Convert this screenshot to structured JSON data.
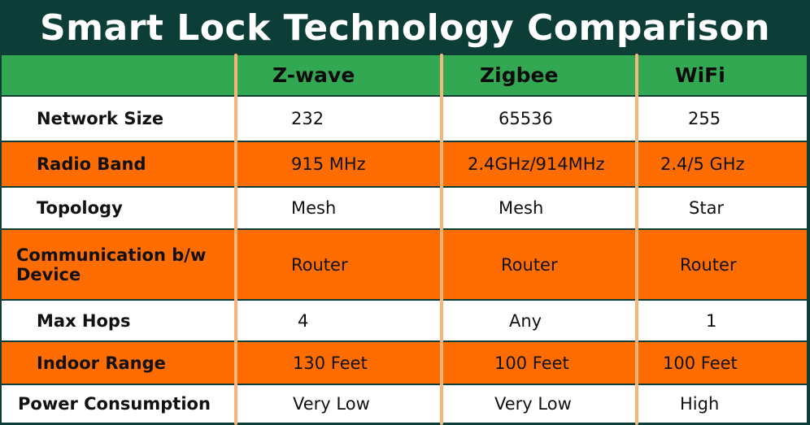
{
  "title": "Smart Lock Technology Comparison",
  "columns": [
    "Z-wave",
    "Zigbee",
    "WiFi"
  ],
  "rows": [
    {
      "label": "Network Size",
      "values": [
        "232",
        "65536",
        "255"
      ]
    },
    {
      "label": "Radio Band",
      "values": [
        "915 MHz",
        "2.4GHz/914MHz",
        "2.4/5 GHz"
      ]
    },
    {
      "label": "Topology",
      "values": [
        "Mesh",
        "Mesh",
        "Star"
      ]
    },
    {
      "label": "Communication b/w Device",
      "label_lines": [
        "Communication b/w",
        "Device"
      ],
      "values": [
        "Router",
        "Router",
        "Router"
      ]
    },
    {
      "label": "Max Hops",
      "values": [
        "4",
        "Any",
        "1"
      ]
    },
    {
      "label": "Indoor Range",
      "values": [
        "130 Feet",
        "100 Feet",
        "100 Feet"
      ]
    },
    {
      "label": "Power Consumption",
      "values": [
        "Very Low",
        "Very Low",
        "High"
      ]
    }
  ],
  "colors": {
    "title_bg": "#0d3d37",
    "header_bg": "#33a853",
    "row_orange": "#ff6c00",
    "row_white": "#ffffff",
    "divider": "#f8b47d"
  }
}
